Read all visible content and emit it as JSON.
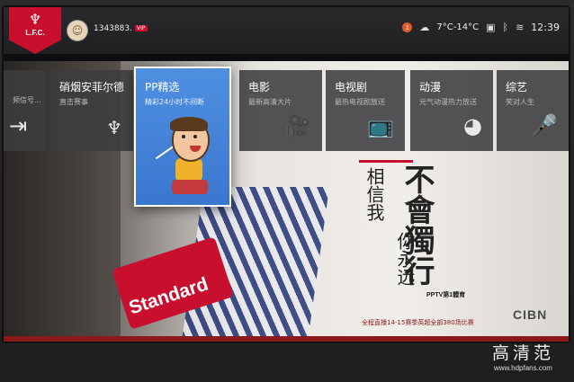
{
  "topbar": {
    "team_badge": "L.F.C.",
    "username": "1343883.",
    "vip": "VIP",
    "notification_count": "1",
    "weather": "7°C-14°C",
    "time": "12:39"
  },
  "tiles": [
    {
      "title": "",
      "subtitle": "频信号...",
      "icon": "exit-icon"
    },
    {
      "title": "硝烟安菲尔德",
      "subtitle": "直击赛事",
      "icon": "lfc-crest-icon"
    },
    {
      "title": "PP精选",
      "subtitle": "精彩24小时不间断",
      "icon": "mascot-illustration",
      "focused": true
    },
    {
      "title": "电影",
      "subtitle": "最新高清大片",
      "icon": "movie-camera-icon"
    },
    {
      "title": "电视剧",
      "subtitle": "最热电视剧放送",
      "icon": "tv-icon"
    },
    {
      "title": "动漫",
      "subtitle": "元气动漫热力放送",
      "icon": "mickey-icon"
    },
    {
      "title": "综艺",
      "subtitle": "笑对人生",
      "icon": "microphone-icon"
    }
  ],
  "hero": {
    "sponsor_text": "Standard",
    "poster_line1": "相信我",
    "poster_line2": "你永远",
    "poster_line3": "不會獨行",
    "poster_logo": "PPTV第1體育",
    "poster_footer": "全程直播14-15赛季英超全部380场比赛",
    "cibn": "CIBN"
  },
  "watermark": {
    "title": "高清范",
    "url": "www.hdpfans.com"
  },
  "colors": {
    "accent_red": "#c8102e",
    "focus_blue": "#3a78d0"
  }
}
